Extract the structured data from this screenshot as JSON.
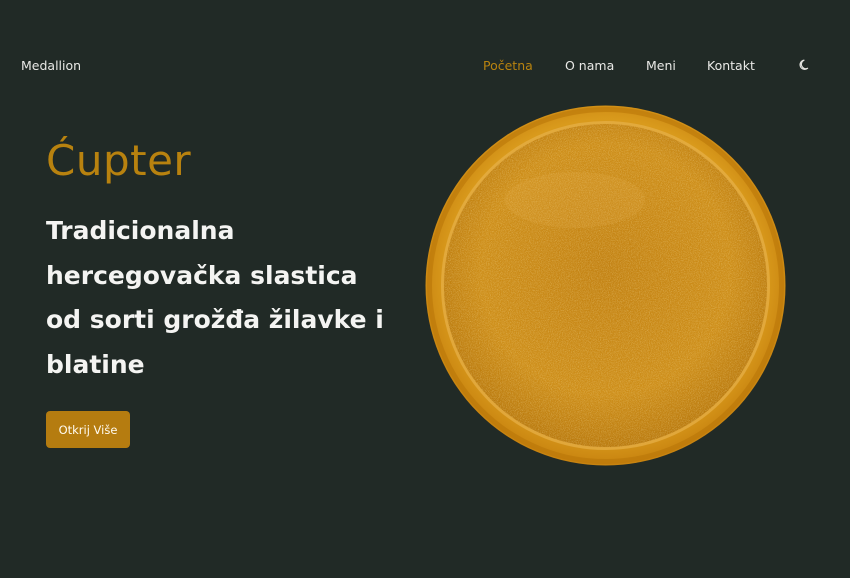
{
  "header": {
    "logo": "Medallion",
    "nav": [
      {
        "label": "Početna",
        "active": true
      },
      {
        "label": "O nama",
        "active": false
      },
      {
        "label": "Meni",
        "active": false
      },
      {
        "label": "Kontakt",
        "active": false
      }
    ],
    "theme_icon": "moon-icon"
  },
  "hero": {
    "title": "Ćupter",
    "subtitle": "Tradicionalna hercegovačka slastica od sorti grožđa žilavke i blatine",
    "cta_label": "Otkrij Više",
    "image_subject": "round amber ćupter sweet"
  },
  "colors": {
    "background": "#212a26",
    "accent": "#b8830f",
    "text": "#f4f4f2"
  }
}
